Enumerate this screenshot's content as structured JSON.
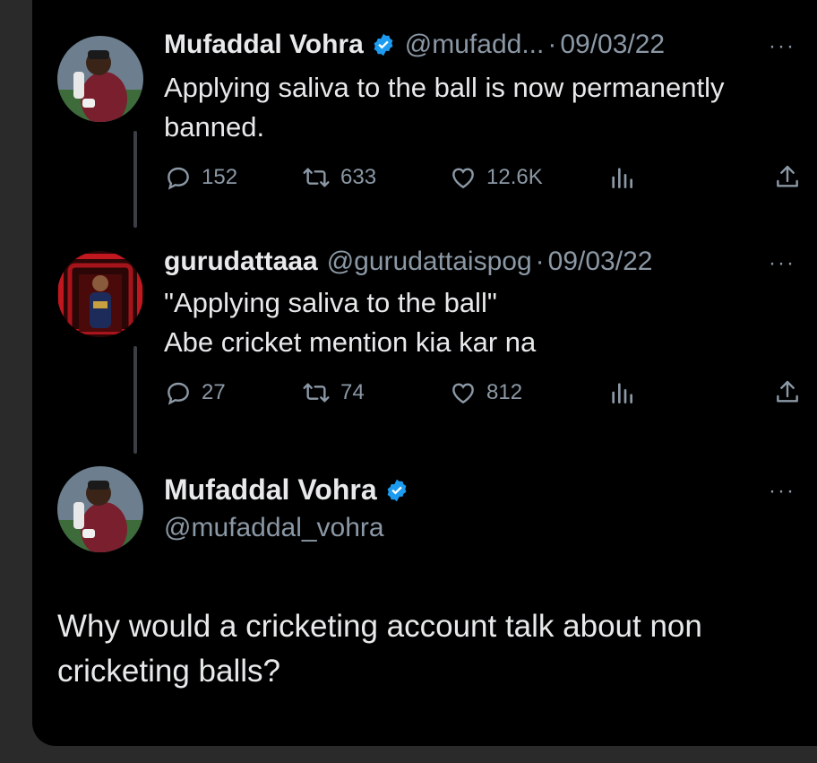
{
  "tweets": [
    {
      "name": "Mufaddal Vohra",
      "handle": "@mufadd...",
      "sep": "·",
      "date": "09/03/22",
      "text": "Applying saliva to the ball is now permanently banned.",
      "replies": "152",
      "retweets": "633",
      "likes": "12.6K",
      "verified": true
    },
    {
      "name": "gurudattaaa",
      "handle": "@gurudattaispog",
      "sep": "·",
      "date": "09/03/22",
      "text": "\"Applying saliva to the ball\"\nAbe cricket mention kia kar na",
      "replies": "27",
      "retweets": "74",
      "likes": "812",
      "verified": false
    }
  ],
  "main_tweet": {
    "name": "Mufaddal Vohra",
    "handle": "@mufaddal_vohra",
    "text": "Why would a cricketing account talk about non cricketing balls?",
    "verified": true
  },
  "more_label": "···",
  "icons": [
    "reply-icon",
    "retweet-icon",
    "like-icon",
    "views-icon",
    "share-icon",
    "verified-icon",
    "more-icon"
  ],
  "colors": {
    "background": "#000000",
    "text": "#e7e9ea",
    "muted": "#8b98a5",
    "verified": "#1d9bf0"
  }
}
